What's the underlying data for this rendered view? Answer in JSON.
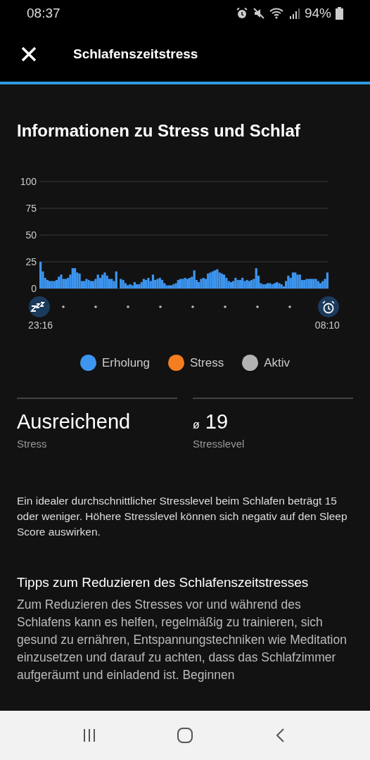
{
  "status_bar": {
    "time": "08:37",
    "battery": "94%"
  },
  "header": {
    "title": "Schlafenszeitstress"
  },
  "section_title": "Informationen zu Stress und Schlaf",
  "chart": {
    "chart_data": {
      "type": "bar",
      "yticks": [
        0,
        25,
        50,
        75,
        100
      ],
      "ylim": [
        0,
        100
      ],
      "grid": true,
      "categories": [
        "23:16",
        null,
        null,
        null,
        null,
        null,
        null,
        null,
        null,
        null,
        null,
        null,
        null,
        null,
        null,
        null,
        null,
        null,
        null,
        null,
        null,
        null,
        null,
        null,
        null,
        null,
        null,
        null,
        null,
        null,
        null,
        null,
        null,
        null,
        null,
        null,
        null,
        null,
        null,
        null,
        null,
        null,
        null,
        null,
        null,
        null,
        null,
        null,
        null,
        null,
        null,
        null,
        null,
        null,
        null,
        null,
        null,
        null,
        null,
        null,
        null,
        null,
        null,
        null,
        null,
        null,
        null,
        null,
        null,
        null,
        null,
        null,
        null,
        null,
        null,
        null,
        null,
        null,
        null,
        null,
        null,
        null,
        null,
        null,
        null,
        null,
        null,
        null,
        null,
        null,
        null,
        null,
        null,
        null,
        null,
        null,
        null,
        null,
        null,
        null,
        null,
        null,
        null,
        null,
        null,
        null,
        null,
        null,
        null,
        null,
        null,
        null,
        null,
        null,
        null,
        null,
        null,
        null,
        null,
        null,
        null,
        null,
        null,
        null,
        null,
        "08:10"
      ],
      "series": [
        {
          "color": "#3d95ef",
          "values": [
            25,
            16,
            10,
            8,
            7,
            7,
            7,
            8,
            11,
            13,
            9,
            9,
            10,
            13,
            19,
            19,
            15,
            14,
            7,
            7,
            9,
            8,
            7,
            7,
            9,
            13,
            10,
            13,
            15,
            12,
            9,
            9,
            7,
            16,
            null,
            9,
            8,
            5,
            3,
            4,
            3,
            6,
            4,
            4,
            6,
            9,
            8,
            10,
            7,
            13,
            8,
            9,
            10,
            8,
            5,
            3,
            3,
            3,
            4,
            5,
            8,
            9,
            9,
            10,
            9,
            10,
            11,
            17,
            8,
            6,
            9,
            10,
            9,
            14,
            15,
            16,
            17,
            18,
            15,
            14,
            13,
            10,
            7,
            6,
            7,
            10,
            8,
            8,
            10,
            7,
            8,
            7,
            8,
            9,
            19,
            12,
            5,
            4,
            4,
            5,
            5,
            4,
            5,
            6,
            5,
            4,
            2,
            7,
            12,
            10,
            15,
            15,
            13,
            13,
            8,
            8,
            9,
            9,
            9,
            9,
            9,
            7,
            5,
            7,
            9,
            15
          ]
        }
      ]
    }
  },
  "legend": [
    {
      "label": "Erholung",
      "color": "#3d95ef"
    },
    {
      "label": "Stress",
      "color": "#f47d20"
    },
    {
      "label": "Aktiv",
      "color": "#b3b3b3"
    }
  ],
  "stats": [
    {
      "value": "Ausreichend",
      "label": "Stress"
    },
    {
      "prefix": "ø",
      "value": "19",
      "label": "Stresslevel"
    }
  ],
  "info_text": "Ein idealer durchschnittlicher Stresslevel beim Schlafen beträgt 15 oder weniger. Höhere Stresslevel können sich negativ auf den Sleep Score auswirken.",
  "tips": {
    "title": "Tipps zum Reduzieren des Schlafenszeitstresses",
    "text": "Zum Reduzieren des Stresses vor und während des Schlafens kann es helfen, regelmäßig zu trainieren, sich gesund zu ernähren, Entspannungstechniken wie Meditation einzusetzen und darauf zu achten, dass das Schlafzimmer aufgeräumt und einladend ist. Beginnen"
  }
}
